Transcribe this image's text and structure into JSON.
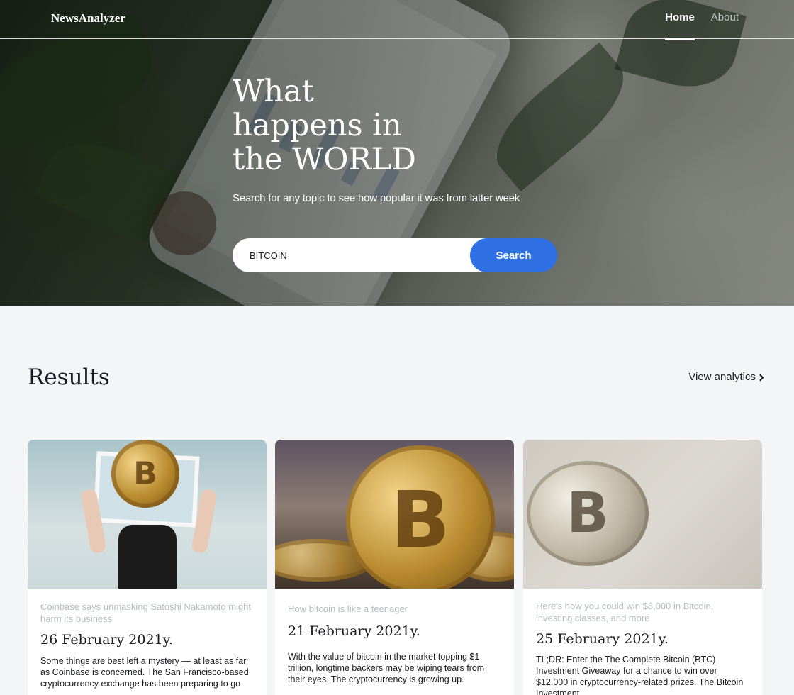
{
  "header": {
    "logo": "NewsAnalyzer",
    "nav": [
      {
        "label": "Home",
        "active": true
      },
      {
        "label": "About",
        "active": false
      }
    ]
  },
  "hero": {
    "title_lines": [
      "What",
      "happens in",
      "the WORLD"
    ],
    "subtitle": "Search for any topic to see how popular it was from latter week",
    "search": {
      "value": "BITCOIN",
      "button_label": "Search"
    }
  },
  "results": {
    "title": "Results",
    "view_analytics_label": "View analytics",
    "cards": [
      {
        "source": "Coinbase says unmasking Satoshi Nakamoto might harm its business",
        "date": "26 February 2021y.",
        "text": "Some things are best left a mystery — at least as far as Coinbase is concerned.  The San Francisco-based cryptocurrency exchange has been preparing to go"
      },
      {
        "source": "How bitcoin is like a teenager",
        "date": "21 February 2021y.",
        "text": "With the value of bitcoin in the market topping $1 trillion, longtime backers may be wiping tears from their eyes. The cryptocurrency is growing up."
      },
      {
        "source": "Here's how you could win $8,000 in Bitcoin, investing classes, and more",
        "date": "25 February 2021y.",
        "text": "TL;DR: Enter the The Complete Bitcoin (BTC) Investment Giveaway for a chance to win over $12,000 in cryptocurrency-related prizes. The Bitcoin Investment"
      }
    ]
  },
  "colors": {
    "accent": "#2f71e5",
    "background": "#f4f5f7",
    "text": "#1a1b22",
    "muted": "#b6bcbf"
  },
  "icons": {
    "view_analytics": "chevron-right-icon",
    "coin": "bitcoin-icon"
  }
}
